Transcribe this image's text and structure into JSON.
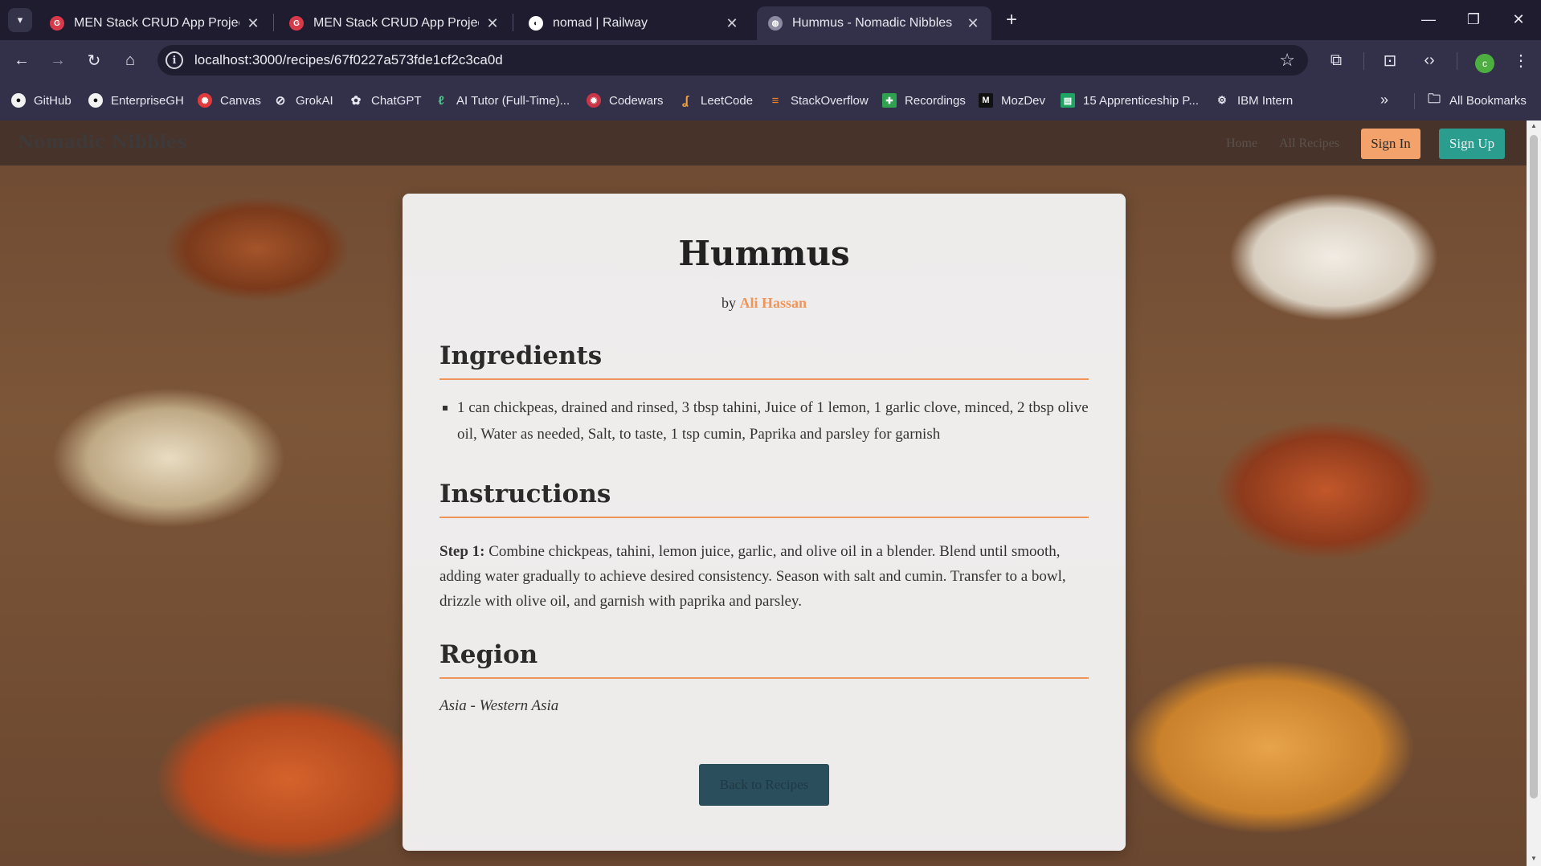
{
  "browser": {
    "tabs": [
      {
        "title": "MEN Stack CRUD App Project R",
        "favicon": "ga-icon",
        "active": false
      },
      {
        "title": "MEN Stack CRUD App Project Ju",
        "favicon": "ga-icon",
        "active": false
      },
      {
        "title": "nomad | Railway",
        "favicon": "railway-icon",
        "active": false
      },
      {
        "title": "Hummus - Nomadic Nibbles",
        "favicon": "globe-icon",
        "active": true
      }
    ],
    "url": "localhost:3000/recipes/67f0227a573fde1cf2c3ca0d",
    "profile_initial": "c",
    "bookmarks": [
      {
        "label": "GitHub",
        "icon": "github-icon"
      },
      {
        "label": "EnterpriseGH",
        "icon": "github-icon"
      },
      {
        "label": "Canvas",
        "icon": "canvas-icon"
      },
      {
        "label": "GrokAI",
        "icon": "grok-icon"
      },
      {
        "label": "ChatGPT",
        "icon": "chatgpt-icon"
      },
      {
        "label": "AI Tutor (Full-Time)...",
        "icon": "tutor-icon"
      },
      {
        "label": "Codewars",
        "icon": "codewars-icon"
      },
      {
        "label": "LeetCode",
        "icon": "leetcode-icon"
      },
      {
        "label": "StackOverflow",
        "icon": "stackoverflow-icon"
      },
      {
        "label": "Recordings",
        "icon": "recordings-icon"
      },
      {
        "label": "MozDev",
        "icon": "mozdev-icon"
      },
      {
        "label": "15 Apprenticeship P...",
        "icon": "sheets-icon"
      },
      {
        "label": "IBM Intern",
        "icon": "ibm-icon"
      }
    ],
    "all_bookmarks_label": "All Bookmarks"
  },
  "site": {
    "brand": "Nomadic Nibbles",
    "nav": {
      "home": "Home",
      "all_recipes": "All Recipes",
      "sign_in": "Sign In",
      "sign_up": "Sign Up"
    }
  },
  "recipe": {
    "title": "Hummus",
    "by_label": "by",
    "author": "Ali Hassan",
    "ingredients_heading": "Ingredients",
    "ingredients": "1 can chickpeas, drained and rinsed, 3 tbsp tahini, Juice of 1 lemon, 1 garlic clove, minced, 2 tbsp olive oil, Water as needed, Salt, to taste, 1 tsp cumin, Paprika and parsley for garnish",
    "instructions_heading": "Instructions",
    "step_label": "Step 1:",
    "step_text": "Combine chickpeas, tahini, lemon juice, garlic, and olive oil in a blender. Blend until smooth, adding water gradually to achieve desired consistency. Season with salt and cumin. Transfer to a bowl, drizzle with olive oil, and garnish with paprika and parsley.",
    "region_heading": "Region",
    "region": "Asia - Western Asia",
    "back_label": "Back to Recipes"
  },
  "colors": {
    "accent": "#f0955a",
    "signup": "#2a9d8f",
    "back_button": "#2a4e5c"
  }
}
